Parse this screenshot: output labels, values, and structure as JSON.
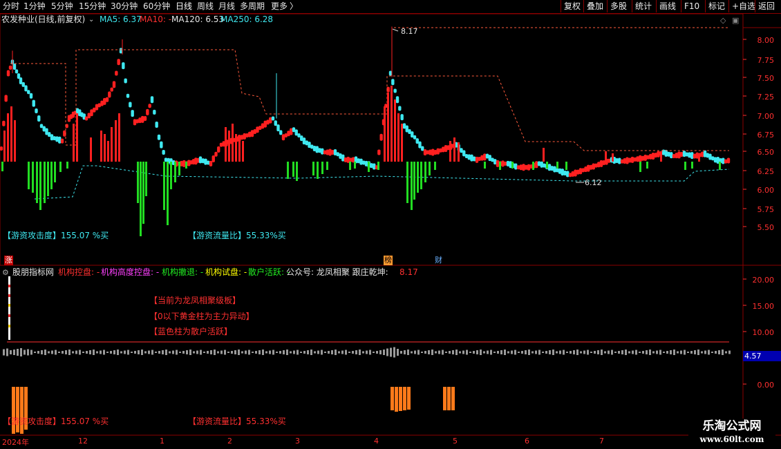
{
  "toolbar": {
    "periods": [
      "分时",
      "1分钟",
      "5分钟",
      "15分钟",
      "30分钟",
      "60分钟",
      "日线",
      "周线",
      "月线",
      "多周期",
      "更多"
    ],
    "more_arrow": "〉",
    "right_buttons": [
      "复权",
      "叠加",
      "多股",
      "统计",
      "画线",
      "F10",
      "标记",
      "+自选",
      "返回"
    ]
  },
  "main_panel": {
    "stock_title": "农发种业(日线,前复权)",
    "ma5": "MA5: 6.37",
    "ma10": "MA10: -",
    "ma120": "MA120: 6.53",
    "ma250": "MA250: 6.28",
    "high_label": "8.17",
    "low_label": "6.12",
    "indicator1": "【游资攻击度】155.07 %买",
    "indicator2": "【游资流量比】55.33%买",
    "y_ticks": [
      "8.00",
      "7.75",
      "7.50",
      "7.25",
      "7.00",
      "6.75",
      "6.50",
      "6.25",
      "6.00",
      "5.75",
      "5.50"
    ],
    "markers": [
      "涨",
      "榜",
      "财"
    ]
  },
  "sub_panel": {
    "title": "股朋指标网",
    "items": [
      {
        "text": "机构控盘: -",
        "color": "#ff3030"
      },
      {
        "text": "机构高度控盘: -",
        "color": "#ff40ff"
      },
      {
        "text": "机构撤退: -",
        "color": "#00ff00"
      },
      {
        "text": "机构试盘: -",
        "color": "#ffff00"
      },
      {
        "text": "散户活跃: -",
        "color": "#00ff00"
      },
      {
        "text": "公众号: 龙凤相聚 跟庄乾坤:",
        "color": "#dddddd"
      },
      {
        "text": "8.17",
        "color": "#ff3030"
      }
    ],
    "notes": [
      "【当前为龙凤相聚级板】",
      "【0以下黄金柱为主力异动】",
      "【蓝色柱为散户活跃】"
    ],
    "indicator1": "【游资攻击度】155.07 %买",
    "indicator2": "【游资流量比】55.33%买",
    "y_ticks": [
      "20.00",
      "15.00",
      "10.00",
      "0.00"
    ],
    "current_value": "4.57"
  },
  "date_axis": [
    "2024年",
    "12",
    "1",
    "2",
    "3",
    "4",
    "5",
    "6",
    "7"
  ],
  "watermark": {
    "line1": "乐淘公式网",
    "line2": "www.60lt.com"
  },
  "colors": {
    "up": "#ff2020",
    "down": "#3fe8f0",
    "green": "#22dd22",
    "orange": "#ff7a1a",
    "border": "#8b0000"
  }
}
